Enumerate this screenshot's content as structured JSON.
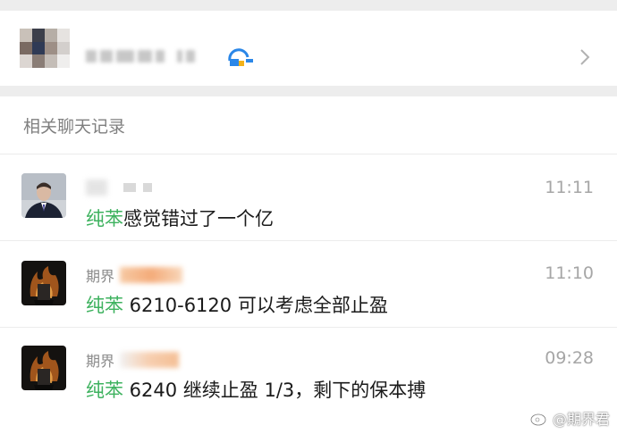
{
  "contact_card": {
    "avatar": "pixelated-avatar",
    "name_obscured": true,
    "icon": "chevron-right-icon"
  },
  "section": {
    "label": "相关聊天记录"
  },
  "messages": [
    {
      "sender": "",
      "time": "11:11",
      "highlight": "纯苯",
      "text": "感觉错过了一个亿",
      "avatar": "person-in-suit-avatar"
    },
    {
      "sender": "期界",
      "time": "11:10",
      "highlight": "纯苯",
      "text": " 6210-6120 可以考虑全部止盈",
      "avatar": "dark-fire-avatar"
    },
    {
      "sender": "期界",
      "time": "09:28",
      "highlight": "纯苯",
      "text": " 6240 继续止盈 1/3，剩下的保本搏",
      "avatar": "dark-fire-avatar"
    }
  ],
  "watermark": {
    "text": "@期界君",
    "icon": "weibo-icon"
  },
  "colors": {
    "highlight": "#3eb25f",
    "background_gap": "#ededed",
    "time_text": "#a6a6a6"
  }
}
